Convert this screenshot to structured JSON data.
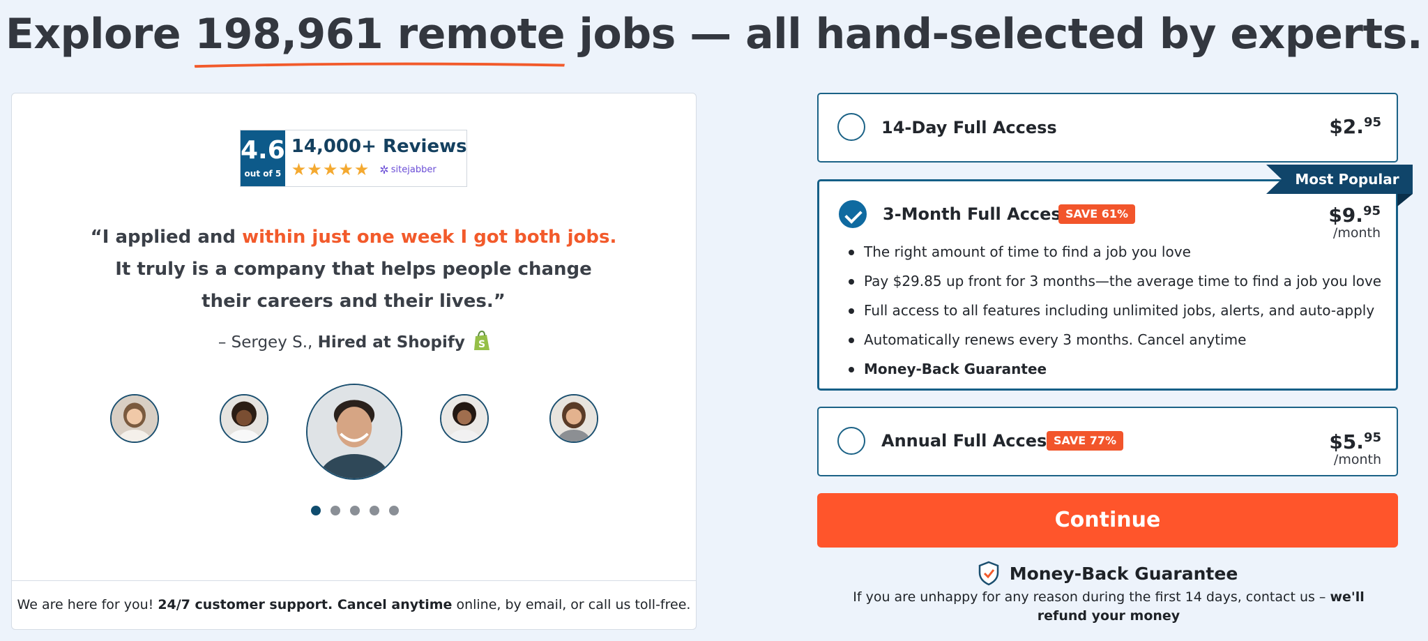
{
  "headline": {
    "prefix": "Explore",
    "highlight": "198,961 remote",
    "suffix": "jobs — all hand-selected by experts."
  },
  "rating": {
    "score": "4.6",
    "out_of": "out of 5",
    "reviews": "14,000+ Reviews",
    "stars": "★★★★★",
    "provider": "sitejabber"
  },
  "testimonial": {
    "quote_start": "“I applied and ",
    "quote_highlight": "within just one week I got both jobs.",
    "quote_end": " It truly is a company that helps people change their careers and their lives.”",
    "author": "– Sergey S., ",
    "company": "Hired at Shopify"
  },
  "carousel": {
    "dot_count": 5,
    "active_index": 0
  },
  "support": {
    "text1": "We are here for you! ",
    "bold1": "24/7 customer support.",
    "bold2": " Cancel anytime",
    "text2": " online, by email, or call us toll-free."
  },
  "plans": [
    {
      "name": "14-Day Full Access",
      "price_main": "$2.",
      "price_cents": "95",
      "per": ""
    },
    {
      "name": "3-Month Full Access",
      "badge": "SAVE 61%",
      "price_main": "$9.",
      "price_cents": "95",
      "per": "/month",
      "features": [
        "The right amount of time to find a job you love",
        "Pay $29.85 up front for 3 months—the average time to find a job you love",
        "Full access to all features including unlimited jobs, alerts, and auto-apply",
        "Automatically renews every 3 months. Cancel anytime",
        "Money-Back Guarantee"
      ]
    },
    {
      "name": "Annual Full Access",
      "badge": "SAVE 77%",
      "price_main": "$5.",
      "price_cents": "95",
      "per": "/month"
    }
  ],
  "ribbon": "Most Popular",
  "continue_label": "Continue",
  "guarantee": {
    "title": "Money-Back Guarantee",
    "text": "If you are unhappy for any reason during the first 14 days, contact us – ",
    "bold": "we'll refund your money"
  },
  "colors": {
    "accent": "#ff552b",
    "primary": "#10456a",
    "background": "#edf3fb"
  }
}
